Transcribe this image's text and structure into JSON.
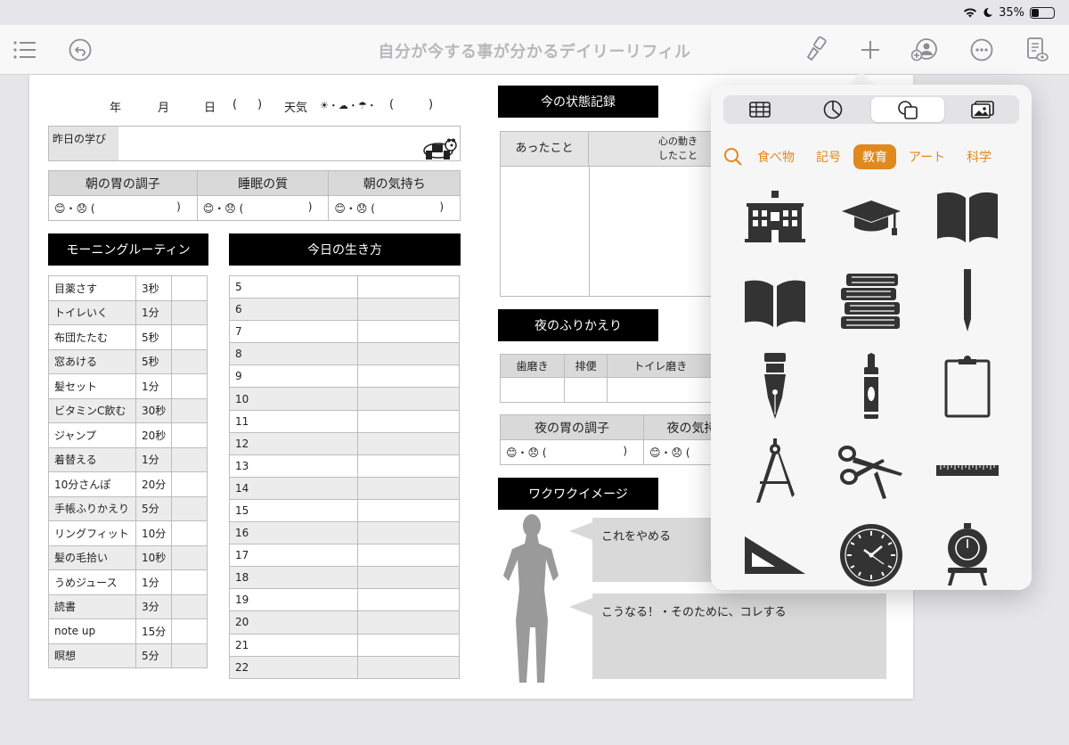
{
  "status": {
    "battery": "35%",
    "battery_level": 0.35
  },
  "toolbar": {
    "title": "自分が今する事が分かるデイリーリフィル"
  },
  "sheet": {
    "date_row": [
      "年",
      "月",
      "日",
      "(",
      ")",
      "天気",
      "☀・☁・☂・",
      "(",
      ")"
    ],
    "learning_label": "昨日の学び",
    "morning_headers": [
      "朝の胃の調子",
      "睡眠の質",
      "朝の気持ち"
    ],
    "mood_scale": "😊・😞 (",
    "mood_close": ")",
    "routine_title": "モーニングルーティン",
    "routine": [
      [
        "目薬さす",
        "3秒"
      ],
      [
        "トイレいく",
        "1分"
      ],
      [
        "布団たたむ",
        "5秒"
      ],
      [
        "窓あける",
        "5秒"
      ],
      [
        "髪セット",
        "1分"
      ],
      [
        "ビタミンC飲む",
        "30秒"
      ],
      [
        "ジャンプ",
        "20秒"
      ],
      [
        "着替える",
        "1分"
      ],
      [
        "10分さんぽ",
        "20分"
      ],
      [
        "手帳ふりかえり",
        "5分"
      ],
      [
        "リングフィット",
        "10分"
      ],
      [
        "髪の毛拾い",
        "10秒"
      ],
      [
        "うめジュース",
        "1分"
      ],
      [
        "読書",
        "3分"
      ],
      [
        "note up",
        "15分"
      ],
      [
        "瞑想",
        "5分"
      ]
    ],
    "life_title": "今日の生き方",
    "hours": [
      "5",
      "6",
      "7",
      "8",
      "9",
      "10",
      "11",
      "12",
      "13",
      "14",
      "15",
      "16",
      "17",
      "18",
      "19",
      "20",
      "21",
      "22"
    ],
    "state_title": "今の状態記録",
    "state_headers": [
      "あったこと",
      "心の動き\nしたこと"
    ],
    "review_title": "夜のふりかえり",
    "review_cols": [
      "歯磨き",
      "排便",
      "トイレ磨き"
    ],
    "night_headers": [
      "夜の胃の調子",
      "夜の気持"
    ],
    "image_title": "ワクワクイメージ",
    "bubble1": "これをやめる",
    "bubble2": "こうなる！・そのために、コレする"
  },
  "popover": {
    "tabs": [
      "table-icon",
      "chart-icon",
      "shapes-icon",
      "media-icon"
    ],
    "active_tab": 2,
    "categories": [
      "食べ物",
      "記号",
      "教育",
      "アート",
      "科学"
    ],
    "active_category": "教育",
    "icons": [
      "school-building-icon",
      "graduation-cap-icon",
      "open-book-icon",
      "open-book-flat-icon",
      "book-stack-icon",
      "pencil-icon",
      "fountain-pen-icon",
      "crayon-icon",
      "clipboard-icon",
      "compass-tool-icon",
      "scissors-icon",
      "ruler-icon",
      "set-square-icon",
      "clock-icon",
      "school-bell-icon"
    ]
  },
  "colors": {
    "accent": "#e0891f",
    "black": "#000000",
    "row_gray": "#ececec",
    "bubble_gray": "#d9d9d9"
  }
}
